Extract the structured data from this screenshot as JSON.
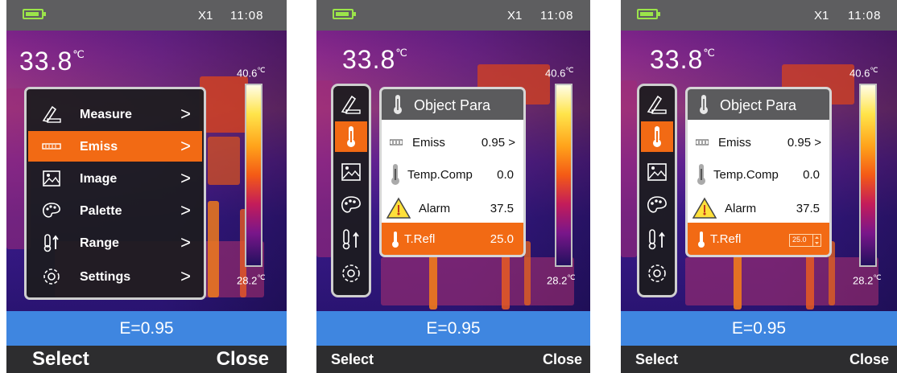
{
  "screens": [
    {
      "status": {
        "zoom": "X1",
        "time": "11:08",
        "battery_icon": "battery-icon"
      },
      "temp_value": "33.8",
      "temp_unit": "℃",
      "scale_max": "40.6",
      "scale_min": "28.2",
      "scale_unit": "℃",
      "menu": [
        {
          "label": "Measure",
          "icon": "measure-icon",
          "arrow": ">"
        },
        {
          "label": "Emiss",
          "icon": "emiss-icon",
          "arrow": ">"
        },
        {
          "label": "Image",
          "icon": "image-icon",
          "arrow": ">"
        },
        {
          "label": "Palette",
          "icon": "palette-icon",
          "arrow": ">"
        },
        {
          "label": "Range",
          "icon": "range-icon",
          "arrow": ">"
        },
        {
          "label": "Settings",
          "icon": "settings-icon",
          "arrow": ">"
        }
      ],
      "emissivity": "E=0.95",
      "softkeys": {
        "left": "Select",
        "right": "Close"
      }
    },
    {
      "status": {
        "zoom": "X1",
        "time": "11:08",
        "battery_icon": "battery-icon"
      },
      "temp_value": "33.8",
      "temp_unit": "℃",
      "scale_max": "40.6",
      "scale_min": "28.2",
      "scale_unit": "℃",
      "panel": {
        "title": "Object Para",
        "rows": [
          {
            "label": "Emiss",
            "value": "0.95 >"
          },
          {
            "label": "Temp.Comp",
            "value": "0.0"
          },
          {
            "label": "Alarm",
            "value": "37.5"
          },
          {
            "label": "T.Refl",
            "value": "25.0"
          }
        ]
      },
      "emissivity": "E=0.95",
      "softkeys": {
        "left": "Select",
        "right": "Close"
      }
    },
    {
      "status": {
        "zoom": "X1",
        "time": "11:08",
        "battery_icon": "battery-icon"
      },
      "temp_value": "33.8",
      "temp_unit": "℃",
      "scale_max": "40.6",
      "scale_min": "28.2",
      "scale_unit": "℃",
      "panel": {
        "title": "Object Para",
        "rows": [
          {
            "label": "Emiss",
            "value": "0.95 >"
          },
          {
            "label": "Temp.Comp",
            "value": "0.0"
          },
          {
            "label": "Alarm",
            "value": "37.5"
          },
          {
            "label": "T.Refl",
            "value": "25.0"
          }
        ]
      },
      "emissivity": "E=0.95",
      "softkeys": {
        "left": "Select",
        "right": "Close"
      }
    }
  ],
  "colors": {
    "accent": "#f26a14",
    "emissivity_bar": "#3f86e0",
    "status_bar": "#5e5e60",
    "battery": "#9be44a"
  },
  "active": {
    "screen1_menu_item": "Emiss",
    "screen2_row": "T.Refl",
    "screen3_row": "T.Refl"
  }
}
